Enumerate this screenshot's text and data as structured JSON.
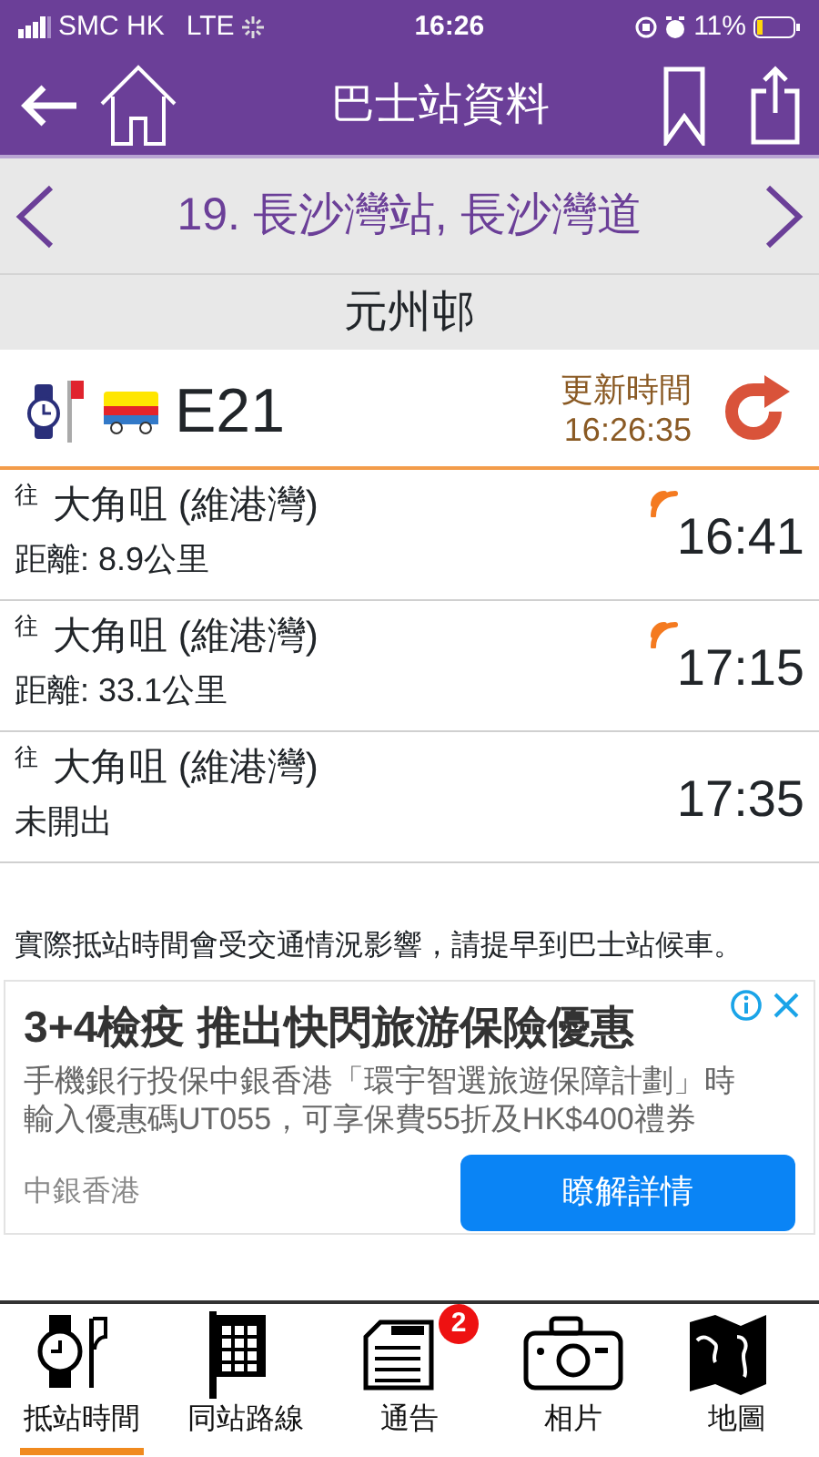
{
  "status_bar": {
    "carrier": "SMC HK",
    "network": "LTE",
    "time": "16:26",
    "battery": "11%"
  },
  "header": {
    "title": "巴士站資料"
  },
  "station": {
    "name": "19. 長沙灣站, 長沙灣道",
    "district": "元州邨"
  },
  "route": {
    "number": "E21",
    "update_label": "更新時間",
    "update_time": "16:26:35"
  },
  "arrivals": [
    {
      "prefix": "往",
      "destination": "大角咀 (維港灣)",
      "detail": "距離: 8.9公里",
      "time": "16:41",
      "realtime": true
    },
    {
      "prefix": "往",
      "destination": "大角咀 (維港灣)",
      "detail": "距離: 33.1公里",
      "time": "17:15",
      "realtime": true
    },
    {
      "prefix": "往",
      "destination": "大角咀 (維港灣)",
      "detail": "未開出",
      "time": "17:35",
      "realtime": false
    }
  ],
  "notice": "實際抵站時間會受交通情況影響，請提早到巴士站候車。",
  "ad": {
    "headline": "3+4檢疫 推出快閃旅游保險優惠",
    "body_lines": [
      "手機銀行投保中銀香港「環宇智選旅遊保障計劃」時",
      "輸入優惠碼UT055，可享保費55折及HK$400禮券"
    ],
    "advertiser": "中銀香港",
    "cta": "瞭解詳情"
  },
  "tabs": [
    {
      "kind": "clock",
      "label": "抵站時間",
      "selected": true
    },
    {
      "kind": "flag",
      "label": "同站路線",
      "selected": false
    },
    {
      "kind": "notice",
      "label": "通告",
      "selected": false,
      "badge": "2"
    },
    {
      "kind": "camera",
      "label": "相片",
      "selected": false
    },
    {
      "kind": "map",
      "label": "地圖",
      "selected": false
    }
  ]
}
